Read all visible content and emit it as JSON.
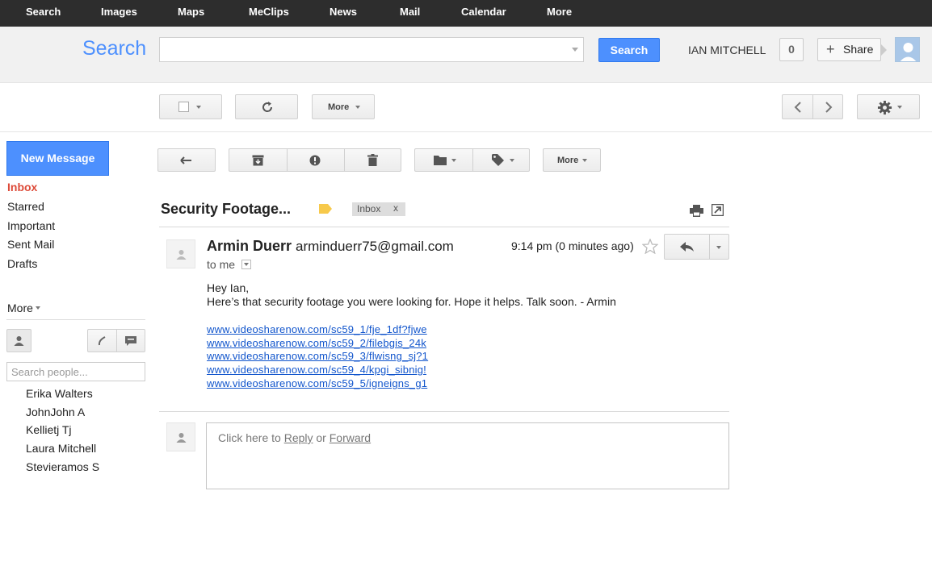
{
  "topnav": {
    "items": [
      {
        "label": "Search"
      },
      {
        "label": "Images"
      },
      {
        "label": "Maps"
      },
      {
        "label": "MeClips"
      },
      {
        "label": "News"
      },
      {
        "label": "Mail"
      },
      {
        "label": "Calendar"
      },
      {
        "label": "More"
      }
    ]
  },
  "header": {
    "logo": "Search",
    "search_value": "",
    "search_button": "Search",
    "username": "IAN MITCHELL",
    "notification_count": "0",
    "share_label": "Share"
  },
  "toolbar": {
    "more_label": "More"
  },
  "message_toolbar": {
    "more_label": "More"
  },
  "sidebar": {
    "compose_label": "New Message",
    "items": [
      {
        "label": "Inbox",
        "active": true
      },
      {
        "label": "Starred"
      },
      {
        "label": "Important"
      },
      {
        "label": "Sent Mail"
      },
      {
        "label": "Drafts"
      }
    ],
    "more_label": "More",
    "people_search_placeholder": "Search people...",
    "contacts": [
      {
        "name": "Erika Walters"
      },
      {
        "name": "JohnJohn A"
      },
      {
        "name": "Kellietj Tj"
      },
      {
        "name": "Laura Mitchell"
      },
      {
        "name": "Stevieramos S"
      }
    ]
  },
  "thread": {
    "subject": "Security Footage...",
    "label": "Inbox",
    "label_remove": "x",
    "label_color": "#f7c94b"
  },
  "message": {
    "sender_name": "Armin Duerr",
    "sender_email": "arminduerr75@gmail.com",
    "time": "9:14 pm",
    "relative_time": "(0 minutes ago)",
    "to": "to me",
    "greeting": "Hey Ian,",
    "body": "Here’s that security footage you were looking for. Hope it helps. Talk soon.  - Armin",
    "links": [
      "www.videosharenow.com/sc59_1/fje_1df?fjwe",
      "www.videosharenow.com/sc59_2/filebgis_24k",
      "www.videosharenow.com/sc59_3/flwisng_sj?1",
      "www.videosharenow.com/sc59_4/kpgi_sibnig!",
      "www.videosharenow.com/sc59_5/igneigns_g1"
    ]
  },
  "reply": {
    "prefix": "Click here to ",
    "reply_link": "Reply",
    "or": " or ",
    "forward_link": "Forward"
  },
  "colors": {
    "accent": "#4d90fe",
    "active_nav": "#dd4b39",
    "link": "#1155cc",
    "topbar": "#2d2d2d"
  }
}
